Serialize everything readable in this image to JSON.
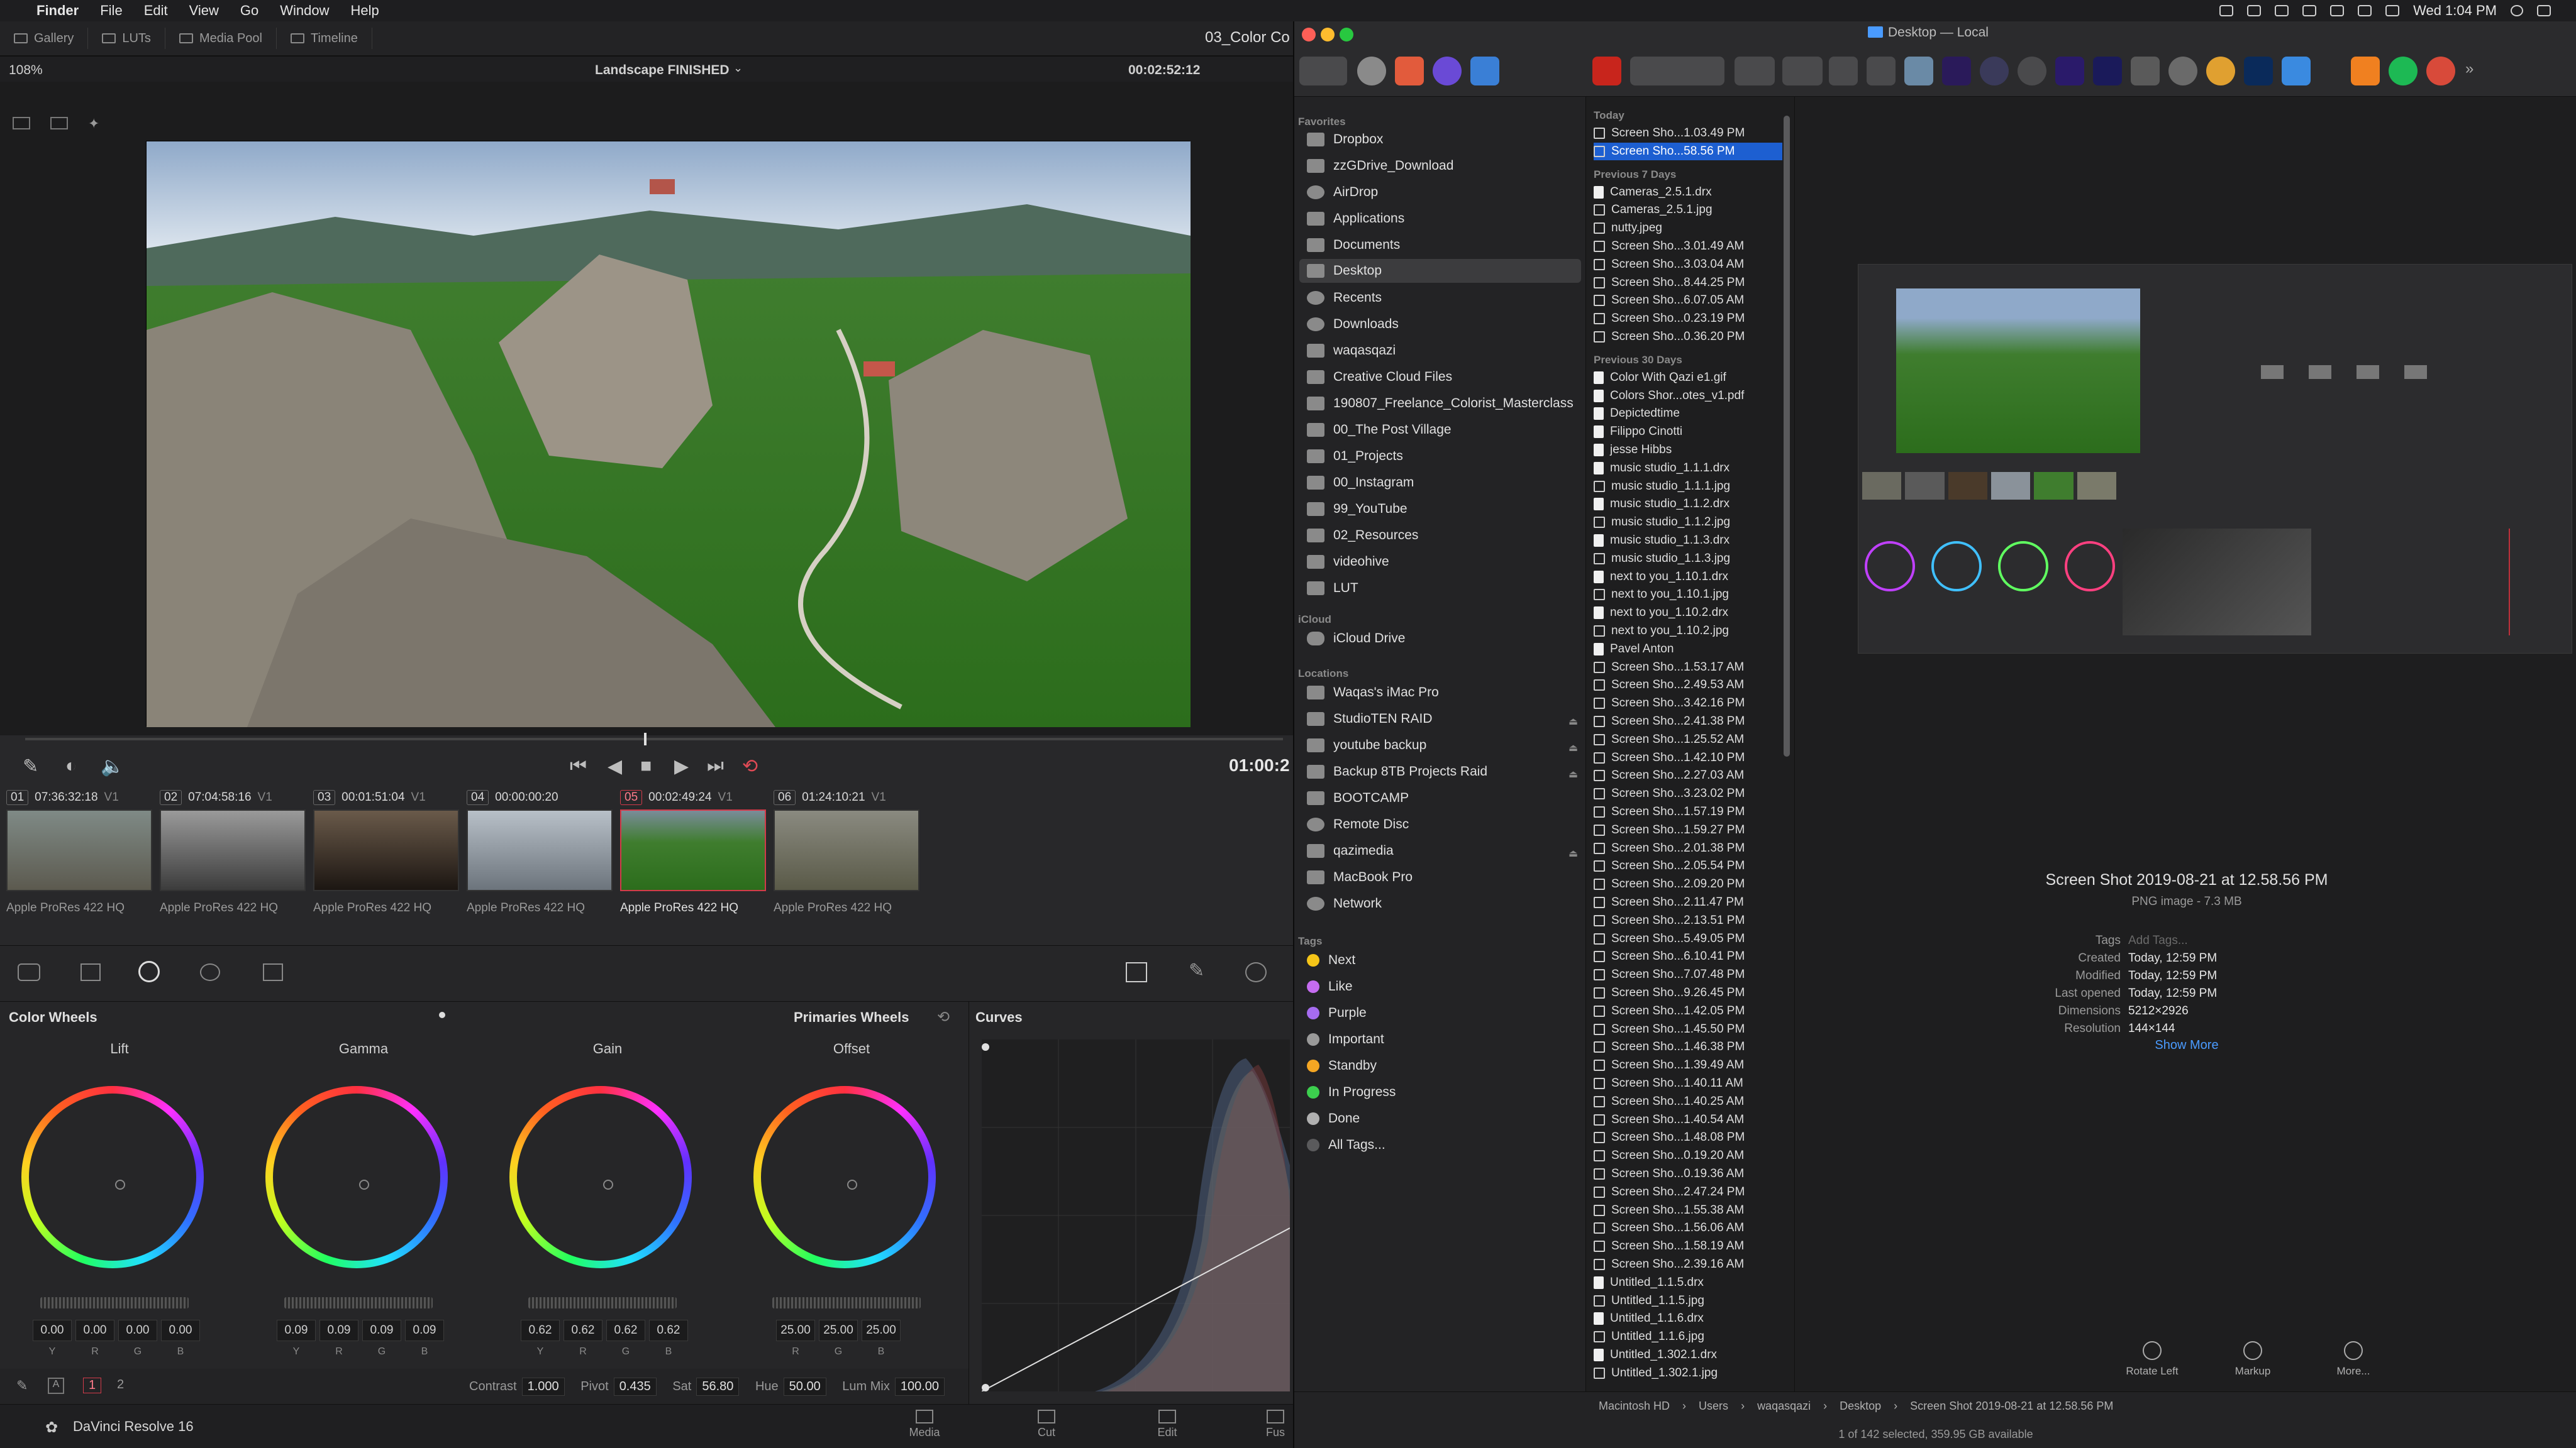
{
  "menubar": {
    "items": [
      "Finder",
      "File",
      "Edit",
      "View",
      "Go",
      "Window",
      "Help"
    ],
    "clock": "Wed 1:04 PM"
  },
  "resolve": {
    "tabs": [
      "Gallery",
      "LUTs",
      "Media Pool",
      "Timeline"
    ],
    "zoom": "108%",
    "timeline_name": "Landscape FINISHED",
    "timecode": "00:02:52:12",
    "project": "03_Color Co",
    "record_tc": "01:00:2",
    "clips": [
      {
        "num": "01",
        "tc": "07:36:32:18",
        "track": "V1",
        "codec": "Apple ProRes 422 HQ"
      },
      {
        "num": "02",
        "tc": "07:04:58:16",
        "track": "V1",
        "codec": "Apple ProRes 422 HQ"
      },
      {
        "num": "03",
        "tc": "00:01:51:04",
        "track": "V1",
        "codec": "Apple ProRes 422 HQ"
      },
      {
        "num": "04",
        "tc": "00:00:00:20",
        "track": "V1",
        "codec": "Apple ProRes 422 HQ"
      },
      {
        "num": "05",
        "tc": "00:02:49:24",
        "track": "V1",
        "codec": "Apple ProRes 422 HQ"
      },
      {
        "num": "06",
        "tc": "01:24:10:21",
        "track": "V1",
        "codec": "Apple ProRes 422 HQ"
      }
    ],
    "color_wheels_title": "Color Wheels",
    "primaries_mode": "Primaries Wheels",
    "curves_title": "Curves",
    "wheels": [
      {
        "name": "Lift",
        "values": [
          "0.00",
          "0.00",
          "0.00",
          "0.00"
        ]
      },
      {
        "name": "Gamma",
        "values": [
          "0.09",
          "0.09",
          "0.09",
          "0.09"
        ]
      },
      {
        "name": "Gain",
        "values": [
          "0.62",
          "0.62",
          "0.62",
          "0.62"
        ]
      },
      {
        "name": "Offset",
        "values": [
          "25.00",
          "25.00",
          "25.00"
        ]
      }
    ],
    "channels4": [
      "Y",
      "R",
      "G",
      "B"
    ],
    "channels3": [
      "R",
      "G",
      "B"
    ],
    "params": {
      "contrast_l": "Contrast",
      "contrast": "1.000",
      "pivot_l": "Pivot",
      "pivot": "0.435",
      "sat_l": "Sat",
      "sat": "56.80",
      "hue_l": "Hue",
      "hue": "50.00",
      "lummix_l": "Lum Mix",
      "lummix": "100.00"
    },
    "pages": [
      "1",
      "2"
    ],
    "app_name": "DaVinci Resolve 16",
    "bottom_tabs": [
      "Media",
      "Cut",
      "Edit",
      "Fus"
    ]
  },
  "finder": {
    "title": "Desktop — Local",
    "sidebar": {
      "favorites_label": "Favorites",
      "favorites": [
        "Dropbox",
        "zzGDrive_Download",
        "AirDrop",
        "Applications",
        "Documents",
        "Desktop",
        "Recents",
        "Downloads",
        "waqasqazi",
        "Creative Cloud Files",
        "190807_Freelance_Colorist_Masterclass",
        "00_The Post Village",
        "01_Projects",
        "00_Instagram",
        "99_YouTube",
        "02_Resources",
        "videohive",
        "LUT"
      ],
      "icloud_label": "iCloud",
      "icloud": [
        "iCloud Drive"
      ],
      "locations_label": "Locations",
      "locations": [
        "Waqas's iMac Pro",
        "StudioTEN RAID",
        "youtube backup",
        "Backup 8TB Projects Raid",
        "BOOTCAMP",
        "Remote Disc",
        "qazimedia",
        "MacBook Pro",
        "Network"
      ],
      "tags_label": "Tags",
      "tags": [
        {
          "name": "Next",
          "color": "#f5c518"
        },
        {
          "name": "Like",
          "color": "#c56cf0"
        },
        {
          "name": "Purple",
          "color": "#a66cf0"
        },
        {
          "name": "Important",
          "color": "#9a9a9a"
        },
        {
          "name": "Standby",
          "color": "#f5a623"
        },
        {
          "name": "In Progress",
          "color": "#3ccf4e"
        },
        {
          "name": "Done",
          "color": "#b0b0b0"
        },
        {
          "name": "All Tags...",
          "color": "#5a5a5c"
        }
      ]
    },
    "files": {
      "today_label": "Today",
      "today": [
        "Screen Sho...1.03.49 PM",
        "Screen Sho...58.56 PM"
      ],
      "prev7_label": "Previous 7 Days",
      "prev7": [
        "Cameras_2.5.1.drx",
        "Cameras_2.5.1.jpg",
        "nutty.jpeg",
        "Screen Sho...3.01.49 AM",
        "Screen Sho...3.03.04 AM",
        "Screen Sho...8.44.25 PM",
        "Screen Sho...6.07.05 AM",
        "Screen Sho...0.23.19 PM",
        "Screen Sho...0.36.20 PM"
      ],
      "prev30_label": "Previous 30 Days",
      "prev30": [
        "Color With Qazi e1.gif",
        "Colors Shor...otes_v1.pdf",
        "Depictedtime",
        "Filippo Cinotti",
        "jesse Hibbs",
        "music studio_1.1.1.drx",
        "music studio_1.1.1.jpg",
        "music studio_1.1.2.drx",
        "music studio_1.1.2.jpg",
        "music studio_1.1.3.drx",
        "music studio_1.1.3.jpg",
        "next to you_1.10.1.drx",
        "next to you_1.10.1.jpg",
        "next to you_1.10.2.drx",
        "next to you_1.10.2.jpg",
        "Pavel Anton",
        "Screen Sho...1.53.17 AM",
        "Screen Sho...2.49.53 AM",
        "Screen Sho...3.42.16 PM",
        "Screen Sho...2.41.38 PM",
        "Screen Sho...1.25.52 AM",
        "Screen Sho...1.42.10 PM",
        "Screen Sho...2.27.03 AM",
        "Screen Sho...3.23.02 PM",
        "Screen Sho...1.57.19 PM",
        "Screen Sho...1.59.27 PM",
        "Screen Sho...2.01.38 PM",
        "Screen Sho...2.05.54 PM",
        "Screen Sho...2.09.20 PM",
        "Screen Sho...2.11.47 PM",
        "Screen Sho...2.13.51 PM",
        "Screen Sho...5.49.05 PM",
        "Screen Sho...6.10.41 PM",
        "Screen Sho...7.07.48 PM",
        "Screen Sho...9.26.45 PM",
        "Screen Sho...1.42.05 PM",
        "Screen Sho...1.45.50 PM",
        "Screen Sho...1.46.38 PM",
        "Screen Sho...1.39.49 AM",
        "Screen Sho...1.40.11 AM",
        "Screen Sho...1.40.25 AM",
        "Screen Sho...1.40.54 AM",
        "Screen Sho...1.48.08 PM",
        "Screen Sho...0.19.20 AM",
        "Screen Sho...0.19.36 AM",
        "Screen Sho...2.47.24 PM",
        "Screen Sho...1.55.38 AM",
        "Screen Sho...1.56.06 AM",
        "Screen Sho...1.58.19 AM",
        "Screen Sho...2.39.16 AM",
        "Untitled_1.1.5.drx",
        "Untitled_1.1.5.jpg",
        "Untitled_1.1.6.drx",
        "Untitled_1.1.6.jpg",
        "Untitled_1.302.1.drx",
        "Untitled_1.302.1.jpg"
      ]
    },
    "preview": {
      "name": "Screen Shot 2019-08-21 at 12.58.56 PM",
      "kind": "PNG image - 7.3 MB",
      "meta": [
        {
          "k": "Tags",
          "v": "Add Tags..."
        },
        {
          "k": "Created",
          "v": "Today, 12:59 PM"
        },
        {
          "k": "Modified",
          "v": "Today, 12:59 PM"
        },
        {
          "k": "Last opened",
          "v": "Today, 12:59 PM"
        },
        {
          "k": "Dimensions",
          "v": "5212×2926"
        },
        {
          "k": "Resolution",
          "v": "144×144"
        }
      ],
      "show_more": "Show More",
      "actions": [
        "Rotate Left",
        "Markup",
        "More..."
      ]
    },
    "path": [
      "Macintosh HD",
      "Users",
      "waqasqazi",
      "Desktop",
      "Screen Shot 2019-08-21 at 12.58.56 PM"
    ],
    "status": "1 of 142 selected, 359.95 GB available"
  }
}
